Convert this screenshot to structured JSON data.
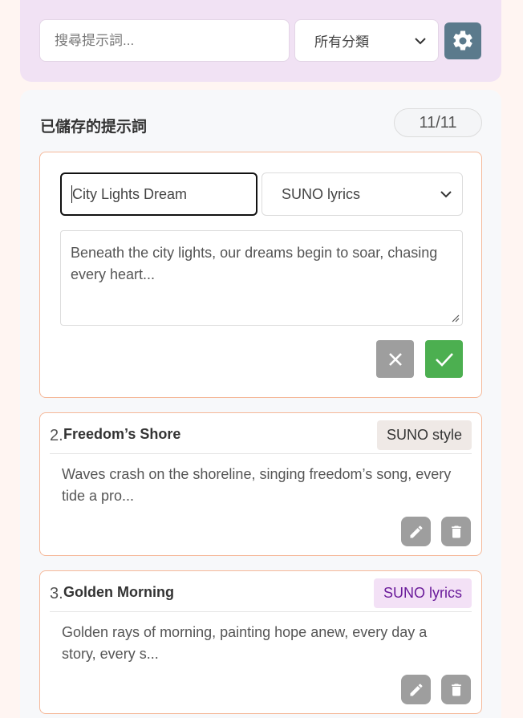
{
  "search": {
    "placeholder": "搜尋提示詞..."
  },
  "category_filter": {
    "selected": "所有分類"
  },
  "saved_section": {
    "title": "已儲存的提示詞",
    "count": "11/11"
  },
  "editor": {
    "title_value": "City Lights Dream",
    "category_value": "SUNO lyrics",
    "content_value": "Beneath the city lights, our dreams begin to soar, chasing every heart..."
  },
  "prompts": [
    {
      "number": "2.",
      "title": "Freedom’s Shore",
      "category": "SUNO style",
      "preview": "Waves crash on the shoreline, singing freedom’s song, every tide a pro..."
    },
    {
      "number": "3.",
      "title": "Golden Morning",
      "category": "SUNO lyrics",
      "preview": "Golden rays of morning, painting hope anew, every day a story, every s..."
    }
  ],
  "colors": {
    "accent_border": "#f5b899",
    "confirm": "#4caf50",
    "neutral_button": "#9e9e9e",
    "settings": "#5b7a8c",
    "lyrics_badge_text": "#6a1b9a"
  }
}
